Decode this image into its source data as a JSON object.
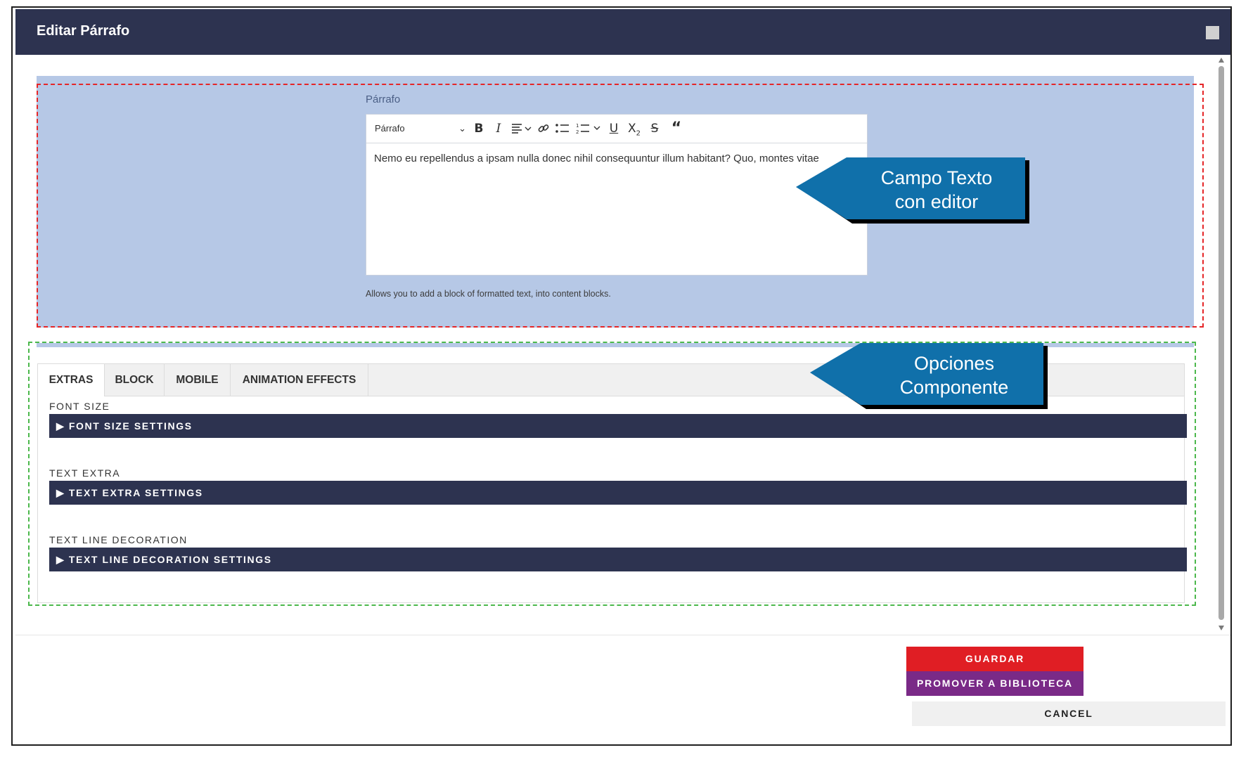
{
  "dialog": {
    "title": "Editar Párrafo"
  },
  "editor": {
    "label": "Párrafo",
    "format_select": "Párrafo",
    "content": "Nemo eu repellendus a ipsam nulla donec nihil consequuntur illum habitant? Quo, montes vitae",
    "help_text": "Allows you to add a block of formatted text, into content blocks."
  },
  "callouts": {
    "editor_callout": [
      "Campo Texto",
      "con editor"
    ],
    "options_callout": [
      "Opciones",
      "Componente"
    ]
  },
  "tabs": [
    "EXTRAS",
    "BLOCK",
    "MOBILE",
    "ANIMATION EFFECTS"
  ],
  "sections": [
    {
      "label": "FONT SIZE",
      "accordion": "▶ FONT SIZE SETTINGS"
    },
    {
      "label": "TEXT EXTRA",
      "accordion": "▶ TEXT EXTRA SETTINGS"
    },
    {
      "label": "TEXT LINE DECORATION",
      "accordion": "▶ TEXT LINE DECORATION SETTINGS"
    }
  ],
  "buttons": {
    "save": "GUARDAR",
    "promote": "PROMOVER A BIBLIOTECA",
    "cancel": "CANCEL"
  },
  "colors": {
    "header": "#2d3350",
    "panel_highlight": "#b6c8e6",
    "callout": "#1070aa",
    "save": "#e01e24",
    "promote": "#7a2a87"
  }
}
